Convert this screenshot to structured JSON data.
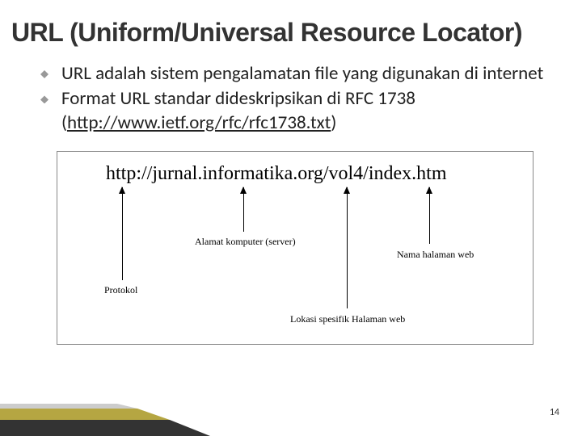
{
  "title": "URL (Uniform/Universal Resource Locator)",
  "bullets": {
    "b1": "URL adalah sistem pengalamatan file yang digunakan di internet",
    "b2a": "Format URL standar dideskripsikan di RFC 1738 (",
    "b2link": "http://www.ietf.org/rfc/rfc1738.txt",
    "b2b": ")"
  },
  "diagram": {
    "url": "http://jurnal.informatika.org/vol4/index.htm",
    "labels": {
      "protokol": "Protokol",
      "alamat": "Alamat komputer (server)",
      "nama": "Nama halaman web",
      "lokasi": "Lokasi spesifik Halaman web"
    }
  },
  "page_number": "14"
}
